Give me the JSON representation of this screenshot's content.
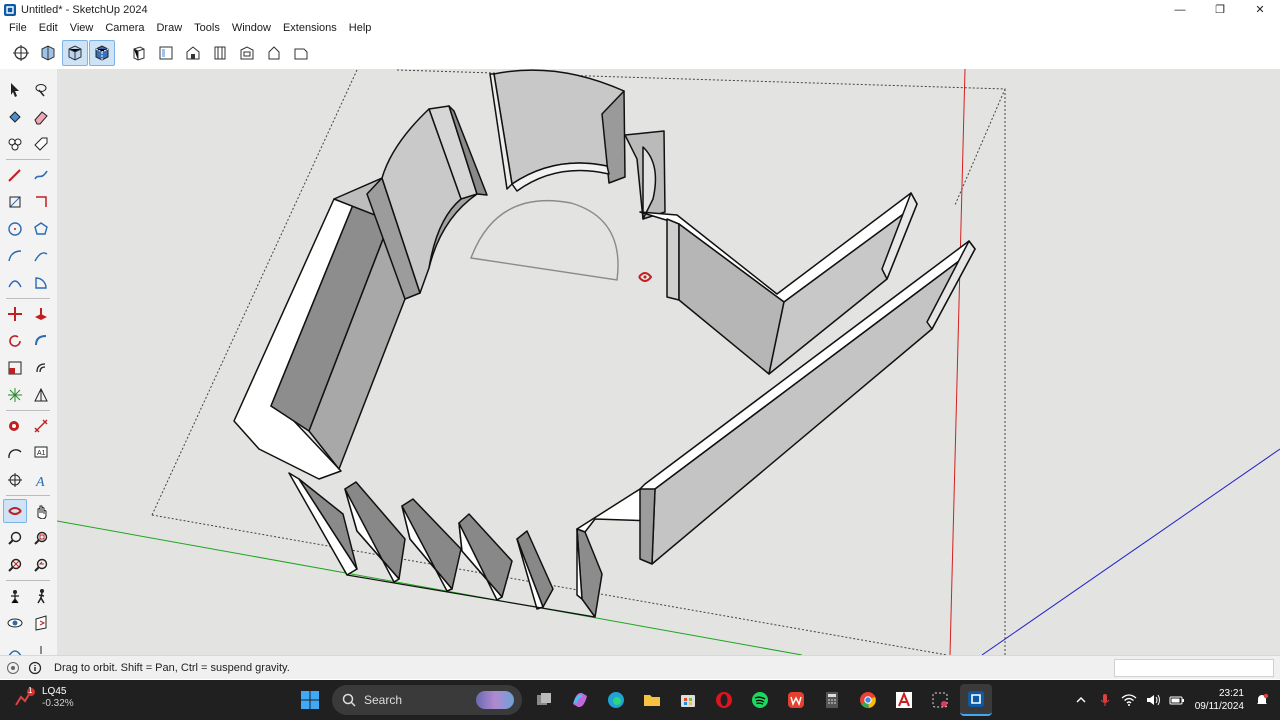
{
  "window": {
    "title": "Untitled* - SketchUp 2024"
  },
  "menu": {
    "items": [
      "File",
      "Edit",
      "View",
      "Camera",
      "Draw",
      "Tools",
      "Window",
      "Extensions",
      "Help"
    ]
  },
  "toolbar": {
    "buttons": [
      "orbit-icon",
      "zoom-extents-icon",
      "x-ray-icon",
      "back-edges-icon",
      "iso-view-icon",
      "top-view-icon",
      "front-view-icon",
      "right-view-icon",
      "back-view-icon",
      "left-view-icon",
      "bottom-view-icon"
    ]
  },
  "status": {
    "hint": "Drag to orbit. Shift = Pan, Ctrl = suspend gravity."
  },
  "taskbar": {
    "weather_temp": "LQ45",
    "weather_change": "-0.32%",
    "weather_badge": "1",
    "search_placeholder": "Search",
    "time": "23:21",
    "date": "09/11/2024"
  },
  "colors": {
    "accent": "#0078d4",
    "axis_red": "#d42020",
    "axis_green": "#1fa51f",
    "axis_blue": "#2222c8",
    "viewport_bg": "#e3e3e1"
  }
}
